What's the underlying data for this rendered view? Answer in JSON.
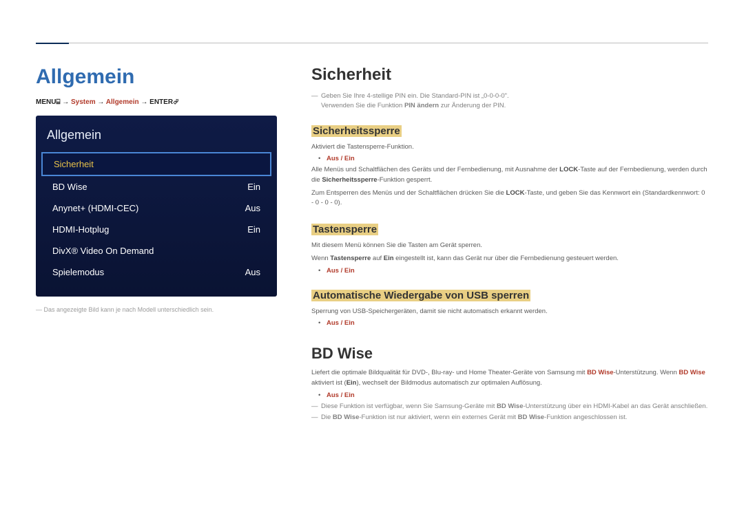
{
  "left": {
    "page_title": "Allgemein",
    "breadcrumb": {
      "menu": "MENU",
      "menu_icon": "⌸",
      "arrow": "→",
      "p1": "System",
      "p2": "Allgemein",
      "enter": "ENTER",
      "enter_icon": "⏎"
    },
    "osd": {
      "title": "Allgemein",
      "items": [
        {
          "label": "Sicherheit",
          "value": "",
          "selected": true
        },
        {
          "label": "BD Wise",
          "value": "Ein",
          "selected": false
        },
        {
          "label": "Anynet+ (HDMI-CEC)",
          "value": "Aus",
          "selected": false
        },
        {
          "label": "HDMI-Hotplug",
          "value": "Ein",
          "selected": false
        },
        {
          "label": "DivX® Video On Demand",
          "value": "",
          "selected": false
        },
        {
          "label": "Spielemodus",
          "value": "Aus",
          "selected": false
        }
      ]
    },
    "footnote": "Das angezeigte Bild kann je nach Modell unterschiedlich sein."
  },
  "right": {
    "h_sicherheit": "Sicherheit",
    "note_pin1_a": "Geben Sie Ihre 4-stellige PIN ein. Die Standard-PIN ist „0-0-0-0\".",
    "note_pin1_b_prefix": "Verwenden Sie die Funktion ",
    "note_pin1_b_bold": "PIN ändern",
    "note_pin1_b_suffix": " zur Änderung der PIN.",
    "h_sicherheitssperre": "Sicherheitssperre",
    "ss_p1": "Aktiviert die Tastensperre-Funktion.",
    "opt_aus_ein": "Aus / Ein",
    "ss_p2_a": "Alle Menüs und Schaltflächen des Geräts und der Fernbedienung, mit Ausnahme der ",
    "ss_p2_lock": "LOCK",
    "ss_p2_b": "-Taste auf der Fernbedienung, werden durch die ",
    "ss_p2_bold": "Sicherheitssperre",
    "ss_p2_c": "-Funktion gesperrt.",
    "ss_p3_a": "Zum Entsperren des Menüs und der Schaltflächen drücken Sie die ",
    "ss_p3_lock": "LOCK",
    "ss_p3_b": "-Taste, und geben Sie das Kennwort ein (Standardkennwort: 0 - 0 - 0 - 0).",
    "h_tastensperre": "Tastensperre",
    "ts_p1": "Mit diesem Menü können Sie die Tasten am Gerät sperren.",
    "ts_p2_a": "Wenn ",
    "ts_p2_b1": "Tastensperre",
    "ts_p2_b": " auf ",
    "ts_p2_b2": "Ein",
    "ts_p2_c": " eingestellt ist, kann das Gerät nur über die Fernbedienung gesteuert werden.",
    "h_usb": "Automatische Wiedergabe von USB sperren",
    "usb_p1": "Sperrung von USB-Speichergeräten, damit sie nicht automatisch erkannt werden.",
    "h_bdwise": "BD Wise",
    "bd_p1_a": "Liefert die optimale Bildqualität für DVD-, Blu-ray- und Home Theater-Geräte von Samsung mit ",
    "bd_p1_b1": "BD Wise",
    "bd_p1_b": "-Unterstützung. Wenn ",
    "bd_p1_b2": "BD Wise",
    "bd_p1_c": " aktiviert ist (",
    "bd_p1_b3": "Ein",
    "bd_p1_d": "), wechselt der Bildmodus automatisch zur optimalen Auflösung.",
    "bd_note1_a": "Diese Funktion ist verfügbar, wenn Sie Samsung-Geräte mit ",
    "bd_note1_b": "BD Wise",
    "bd_note1_c": "-Unterstützung über ein HDMI-Kabel an das Gerät anschließen.",
    "bd_note2_a": "Die ",
    "bd_note2_b1": "BD Wise",
    "bd_note2_b": "-Funktion ist nur aktiviert, wenn ein externes Gerät mit ",
    "bd_note2_b2": "BD Wise",
    "bd_note2_c": "-Funktion angeschlossen ist."
  }
}
